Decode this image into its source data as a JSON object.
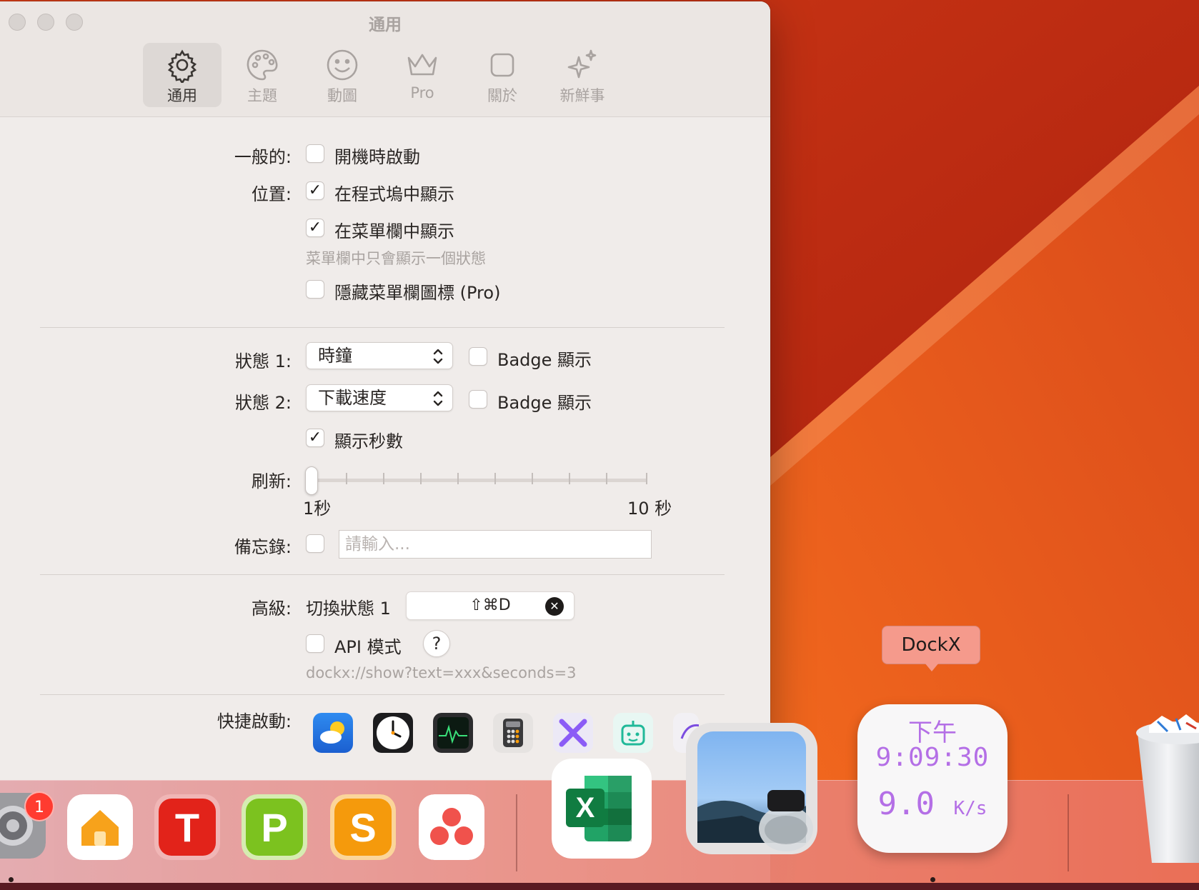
{
  "window": {
    "title": "通用",
    "tabs": [
      {
        "label": "通用",
        "icon": "gear-icon",
        "active": true
      },
      {
        "label": "主題",
        "icon": "palette-icon",
        "active": false
      },
      {
        "label": "動圖",
        "icon": "smiley-icon",
        "active": false
      },
      {
        "label": "Pro",
        "icon": "crown-icon",
        "active": false
      },
      {
        "label": "關於",
        "icon": "square-icon",
        "active": false
      },
      {
        "label": "新鮮事",
        "icon": "sparkles-icon",
        "active": false
      }
    ]
  },
  "general": {
    "label": "一般的:",
    "launch_at_login": {
      "label": "開機時啟動",
      "checked": false
    }
  },
  "position": {
    "label": "位置:",
    "show_in_dock": {
      "label": "在程式塢中顯示",
      "checked": true
    },
    "show_in_menubar": {
      "label": "在菜單欄中顯示",
      "checked": true
    },
    "menubar_hint": "菜單欄中只會顯示一個狀態",
    "hide_menubar_icon": {
      "label": "隱藏菜單欄圖標 (Pro)",
      "checked": false
    }
  },
  "status1": {
    "label": "狀態 1:",
    "value": "時鐘",
    "badge_label": "Badge 顯示",
    "badge_checked": false
  },
  "status2": {
    "label": "狀態 2:",
    "value": "下載速度",
    "badge_label": "Badge 顯示",
    "badge_checked": false
  },
  "show_seconds": {
    "label": "顯示秒數",
    "checked": true
  },
  "refresh": {
    "label": "刷新:",
    "min_label": "1秒",
    "max_label": "10 秒",
    "value_seconds": 1,
    "min": 1,
    "max": 10
  },
  "memo": {
    "label": "備忘錄:",
    "checked": false,
    "placeholder": "請輸入..."
  },
  "advanced": {
    "label": "高級:",
    "toggle_label": "切換狀態 1",
    "shortcut": "⇧⌘D",
    "api_mode": {
      "label": "API 模式",
      "checked": false
    },
    "help": "?",
    "api_hint": "dockx://show?text=xxx&seconds=3"
  },
  "quick_launch": {
    "label": "快捷啟動:",
    "apps": [
      "weather-app-icon",
      "clock-app-icon",
      "activity-monitor-icon",
      "calculator-icon",
      "x-app-icon",
      "robot-app-icon",
      "partial-app-icon"
    ]
  },
  "dock": {
    "system_settings_badge": "1",
    "tooltip": "DockX",
    "dockx_tile": {
      "line1": "下午",
      "line2": "9:09:30",
      "speed": "9.0",
      "unit": "K/s"
    },
    "colors": {
      "dockx_text": "#b46fe6",
      "tooltip_bg": "#f59a8c",
      "badge": "#ff3b30"
    }
  }
}
